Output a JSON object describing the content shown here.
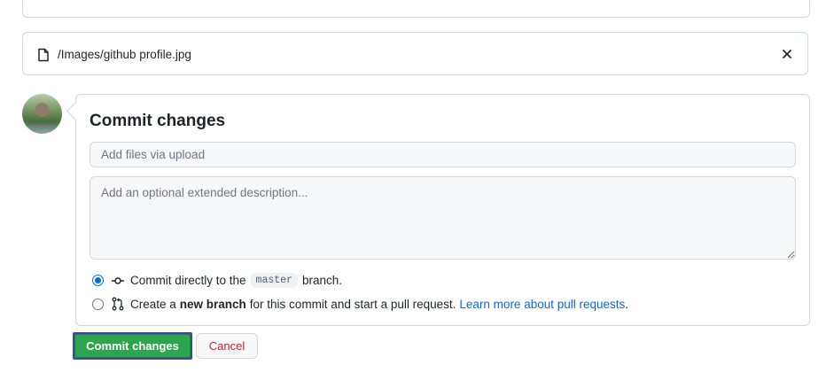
{
  "file": {
    "path": "/Images/github profile.jpg"
  },
  "commit": {
    "title": "Commit changes",
    "summary_placeholder": "Add files via upload",
    "description_placeholder": "Add an optional extended description...",
    "options": {
      "direct_prefix": "Commit directly to the",
      "branch_name": "master",
      "direct_suffix": "branch.",
      "new_prefix": "Create a",
      "new_bold": "new branch",
      "new_suffix": "for this commit and start a pull request.",
      "learn_more": "Learn more about pull requests",
      "learn_more_end": "."
    },
    "selected_option": "direct"
  },
  "buttons": {
    "commit_label": "Commit changes",
    "cancel_label": "Cancel"
  },
  "colors": {
    "primary_button": "#2da44e",
    "link": "#0969da",
    "danger": "#cf222e"
  }
}
